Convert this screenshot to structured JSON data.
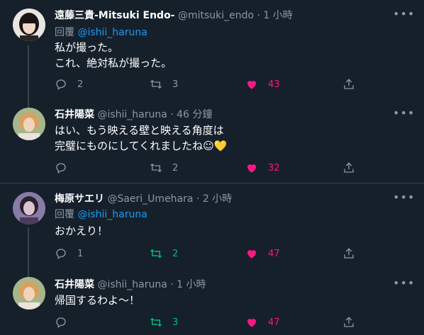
{
  "tweets": [
    {
      "name": "遠藤三貴-Mitsuki Endo-",
      "handle": "@mitsuki_endo",
      "time": "· 1 小時",
      "reply_prefix": "回覆",
      "reply_handle": "@ishii_haruna",
      "lines": [
        "私が撮った。",
        "これ、絶対私が撮った。"
      ],
      "replies": "2",
      "retweets": "3",
      "likes": "43"
    },
    {
      "name": "石井陽菜",
      "handle": "@ishii_haruna",
      "time": "· 46 分鐘",
      "lines": [
        "はい、もう映える壁と映える角度は",
        "完璧にものにしてくれましたね☺💛"
      ],
      "replies": "",
      "retweets": "2",
      "likes": "32"
    },
    {
      "name": "梅原サエリ",
      "handle": "@Saeri_Umehara",
      "time": "· 2 小時",
      "reply_prefix": "回覆",
      "reply_handle": "@ishii_haruna",
      "lines": [
        "おかえり！"
      ],
      "replies": "1",
      "retweets": "2",
      "likes": "47"
    },
    {
      "name": "石井陽菜",
      "handle": "@ishii_haruna",
      "time": "· 1 小時",
      "lines": [
        "帰国するわよ〜！"
      ],
      "replies": "",
      "retweets": "3",
      "likes": "47"
    }
  ],
  "colors": {
    "background": "#15202b",
    "muted": "#8b98a5",
    "link": "#1d9bf0",
    "like_active": "#f91880",
    "retweet_active": "#00ba7c"
  },
  "icons": [
    "more-icon",
    "reply-icon",
    "retweet-icon",
    "heart-icon",
    "share-icon"
  ]
}
